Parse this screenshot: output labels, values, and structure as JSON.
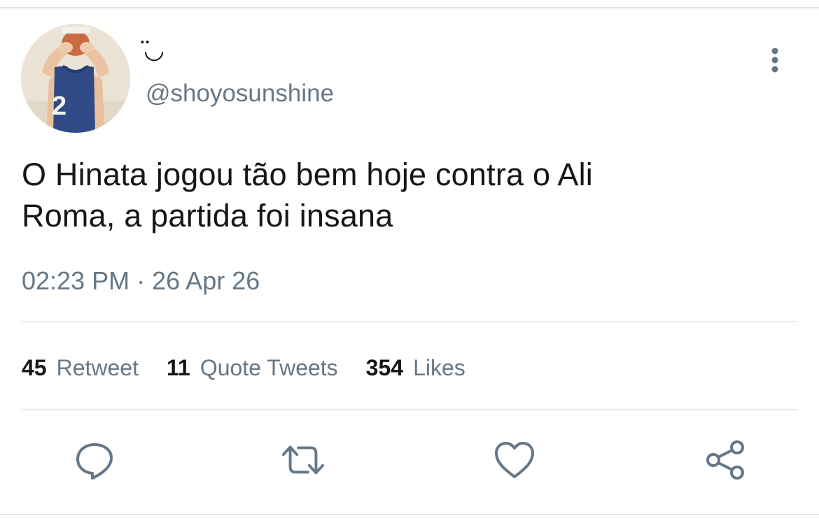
{
  "user": {
    "display_name": "̈◡",
    "handle": "@shoyosunshine",
    "avatar_icon": "avatar-photo-volleyball-player-number-2"
  },
  "tweet": {
    "text_line1": "O Hinata jogou tão bem hoje contra o Ali",
    "text_line2": "Roma, a partida foi insana",
    "time": "02:23 PM",
    "separator": "·",
    "date": "26 Apr 26"
  },
  "stats": {
    "retweets": {
      "count": "45",
      "label": "Retweet"
    },
    "quotes": {
      "count": "11",
      "label": "Quote Tweets"
    },
    "likes": {
      "count": "354",
      "label": "Likes"
    }
  },
  "actions": {
    "reply_icon": "reply-icon",
    "retweet_icon": "retweet-icon",
    "like_icon": "heart-icon",
    "share_icon": "share-icon",
    "more_icon": "more-vertical-icon"
  },
  "colors": {
    "text": "#14171a",
    "secondary": "#657786",
    "divider": "#e6ecf0",
    "icon": "#657786"
  }
}
